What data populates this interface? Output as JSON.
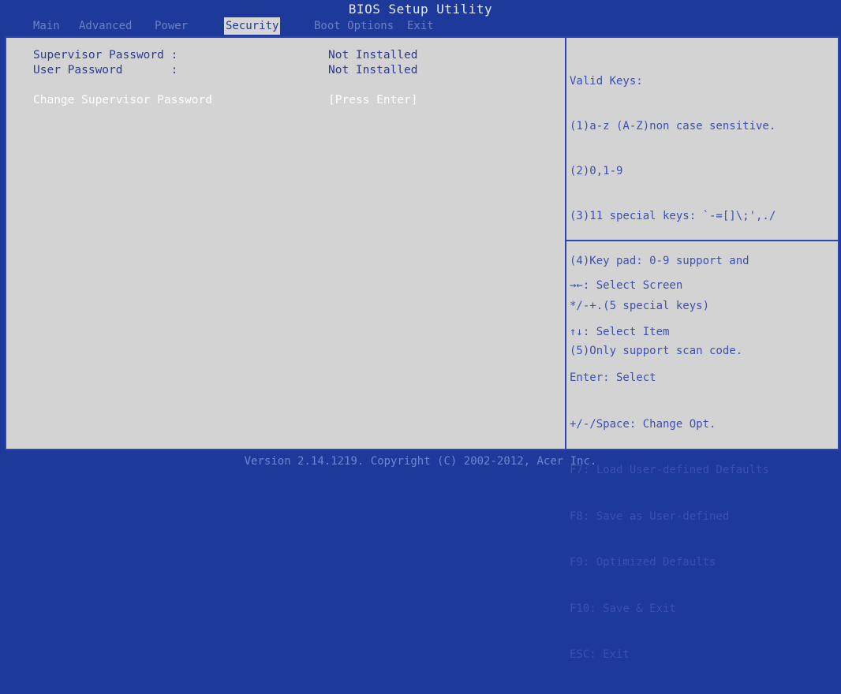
{
  "window": {
    "title": "BIOS Setup Utility"
  },
  "tabs": [
    {
      "label": "Main",
      "active": false
    },
    {
      "label": "Advanced",
      "active": false
    },
    {
      "label": "Power",
      "active": false
    },
    {
      "label": "Security",
      "active": true
    },
    {
      "label": "Boot Options",
      "active": false
    },
    {
      "label": "Exit",
      "active": false
    }
  ],
  "settings": [
    {
      "label": "Supervisor Password :",
      "value": "Not Installed"
    },
    {
      "label": "User Password       :",
      "value": "Not Installed"
    },
    {
      "label": "Change Supervisor Password",
      "value": "[Press Enter]",
      "selected": true
    }
  ],
  "help": {
    "lines": [
      "Valid Keys:",
      "(1)a-z (A-Z)non case sensitive.",
      "(2)0,1-9",
      "(3)11 special keys: `-=[]\\;',./",
      "(4)Key pad: 0-9 support and",
      "*/-+.(5 special keys)",
      "(5)Only support scan code."
    ]
  },
  "keys": [
    "→←: Select Screen",
    "↑↓: Select Item",
    "Enter: Select",
    "+/-/Space: Change Opt.",
    "F7: Load User-defined Defaults",
    "F8: Save as User-defined",
    "F9: Optimized Defaults",
    "F10: Save & Exit",
    "ESC: Exit"
  ],
  "footer": {
    "text": "Version 2.14.1219. Copyright (C) 2002-2012, Acer Inc."
  },
  "colors": {
    "background": "#1d3a9a",
    "panel": "#d3d3d3",
    "active_tab_bg": "#d6d6d6",
    "text": "#2e3a8c",
    "selected_text": "#ffffff"
  }
}
